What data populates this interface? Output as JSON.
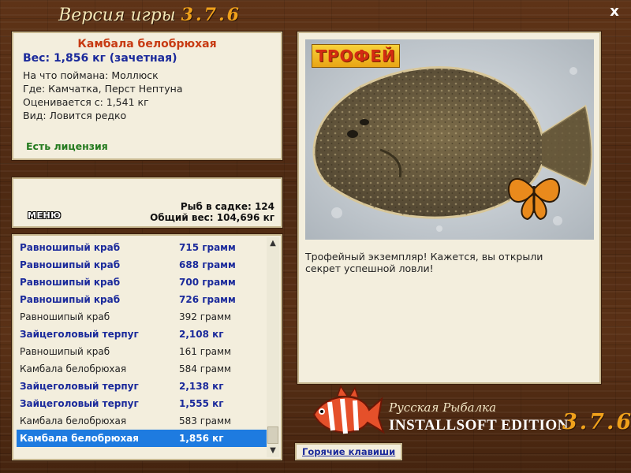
{
  "header": {
    "title_prefix": "Версия игры",
    "version": "3.7.6",
    "close_label": "x"
  },
  "catch_info": {
    "name": "Камбала белобрюхая",
    "weight": "Вес: 1,856 кг (зачетная)",
    "caught_with": "На что поймана: Моллюск",
    "location": "Где: Камчатка, Перст Нептуна",
    "valued_from": "Оценивается с: 1,541 кг",
    "kind": "Вид: Ловится редко",
    "license": "Есть лицензия"
  },
  "stats": {
    "menu_label": "МЕНЮ",
    "fish_in_keepnet": "Рыб в садке: 124",
    "total_weight": "Общий вес: 104,696 кг"
  },
  "catch_list": [
    {
      "name": "Равношипый краб",
      "weight": "715 грамм",
      "style": "trophy"
    },
    {
      "name": "Равношипый краб",
      "weight": "688 грамм",
      "style": "trophy"
    },
    {
      "name": "Равношипый краб",
      "weight": "700 грамм",
      "style": "trophy"
    },
    {
      "name": "Равношипый краб",
      "weight": "726 грамм",
      "style": "trophy"
    },
    {
      "name": "Равношипый краб",
      "weight": "392 грамм",
      "style": "normal"
    },
    {
      "name": "Зайцеголовый терпуг",
      "weight": "2,108 кг",
      "style": "trophy"
    },
    {
      "name": "Равношипый краб",
      "weight": "161 грамм",
      "style": "normal"
    },
    {
      "name": "Камбала белобрюхая",
      "weight": "584 грамм",
      "style": "normal"
    },
    {
      "name": "Зайцеголовый терпуг",
      "weight": "2,138 кг",
      "style": "trophy"
    },
    {
      "name": "Зайцеголовый терпуг",
      "weight": "1,555 кг",
      "style": "trophy"
    },
    {
      "name": "Камбала белобрюхая",
      "weight": "583 грамм",
      "style": "normal"
    },
    {
      "name": "Камбала белобрюхая",
      "weight": "1,856 кг",
      "style": "selected"
    }
  ],
  "photo": {
    "badge": "ТРОФЕЙ",
    "description": "Трофейный экземпляр! Кажется, вы открыли секрет успешной ловли!"
  },
  "branding": {
    "line1": "Русская Рыбалка",
    "line2": "INSTALLSOFT EDITION",
    "version": "3.7.6"
  },
  "hotkeys_label": "Горячие клавиши",
  "colors": {
    "trophy_text": "#1b2a9b",
    "selection": "#1e7be0",
    "fish_name": "#c73a12",
    "license": "#237a1e",
    "accent_orange": "#f0a11b"
  }
}
